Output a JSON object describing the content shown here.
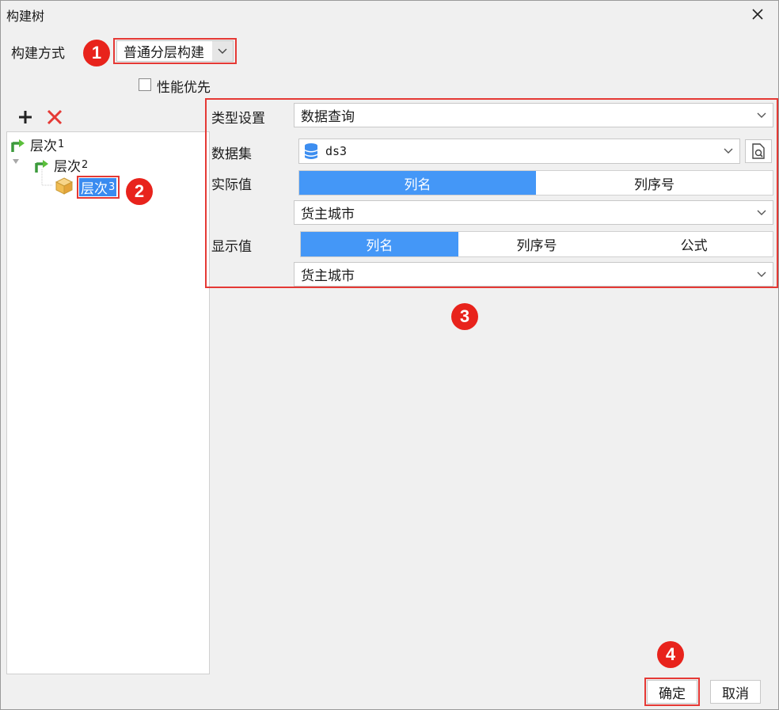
{
  "window": {
    "title": "构建树"
  },
  "build": {
    "mode_label": "构建方式",
    "mode_value": "普通分层构建",
    "priority_label": "性能优先"
  },
  "tree": {
    "items": [
      {
        "text": "层次",
        "num": "1"
      },
      {
        "text": "层次",
        "num": "2"
      },
      {
        "text": "层次",
        "num": "3"
      }
    ]
  },
  "settings": {
    "type_label": "类型设置",
    "type_value": "数据查询",
    "dataset_label": "数据集",
    "dataset_value": "ds3",
    "actual_label": "实际值",
    "actual_tabs": [
      "列名",
      "列序号"
    ],
    "actual_value": "货主城市",
    "display_label": "显示值",
    "display_tabs": [
      "列名",
      "列序号",
      "公式"
    ],
    "display_value": "货主城市"
  },
  "badges": [
    "1",
    "2",
    "3",
    "4"
  ],
  "footer": {
    "ok_label": "确定",
    "cancel_label": "取消"
  },
  "colors": {
    "accent": "#4497f7",
    "highlight": "#e53935",
    "badge": "#e8231c",
    "delete": "#e53935"
  }
}
